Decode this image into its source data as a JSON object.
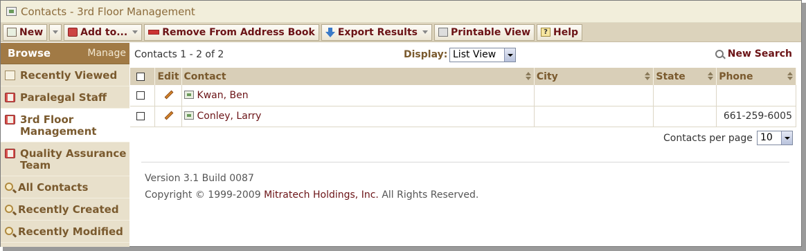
{
  "window": {
    "title": "Contacts - 3rd Floor Management"
  },
  "toolbar": {
    "new_label": "New",
    "add_to_label": "Add to...",
    "remove_label": "Remove From Address Book",
    "export_label": "Export Results",
    "printable_label": "Printable View",
    "help_label": "Help"
  },
  "sidebar": {
    "browse_label": "Browse",
    "manage_label": "Manage",
    "items": [
      {
        "label": "Recently Viewed",
        "icon": "recently-viewed-icon"
      },
      {
        "label": "Paralegal Staff",
        "icon": "address-book-icon"
      },
      {
        "label": "3rd Floor Management",
        "icon": "address-book-icon"
      },
      {
        "label": "Quality Assurance Team",
        "icon": "address-book-icon"
      },
      {
        "label": "All Contacts",
        "icon": "search-icon"
      },
      {
        "label": "Recently Created",
        "icon": "search-icon"
      },
      {
        "label": "Recently Modified",
        "icon": "search-icon"
      }
    ]
  },
  "main": {
    "count_text": "Contacts 1 - 2 of 2",
    "display_label": "Display:",
    "display_value": "List View",
    "new_search_label": "New Search",
    "columns": [
      "Edit",
      "Contact",
      "City",
      "State",
      "Phone"
    ],
    "rows": [
      {
        "contact": "Kwan, Ben",
        "city": "",
        "state": "",
        "phone": ""
      },
      {
        "contact": "Conley, Larry",
        "city": "",
        "state": "",
        "phone": "661-259-6005"
      }
    ],
    "per_page_label": "Contacts per page",
    "per_page_value": "10"
  },
  "footer": {
    "version": "Version 3.1 Build 0087",
    "copyright_prefix": "Copyright © 1999-2009",
    "company": "Mitratech Holdings, Inc.",
    "copyright_suffix": "All Rights Reserved."
  },
  "colors": {
    "accent": "#6b1316",
    "sidebar_header": "#a17a45",
    "toolbar_bg": "#dcd3bc"
  }
}
